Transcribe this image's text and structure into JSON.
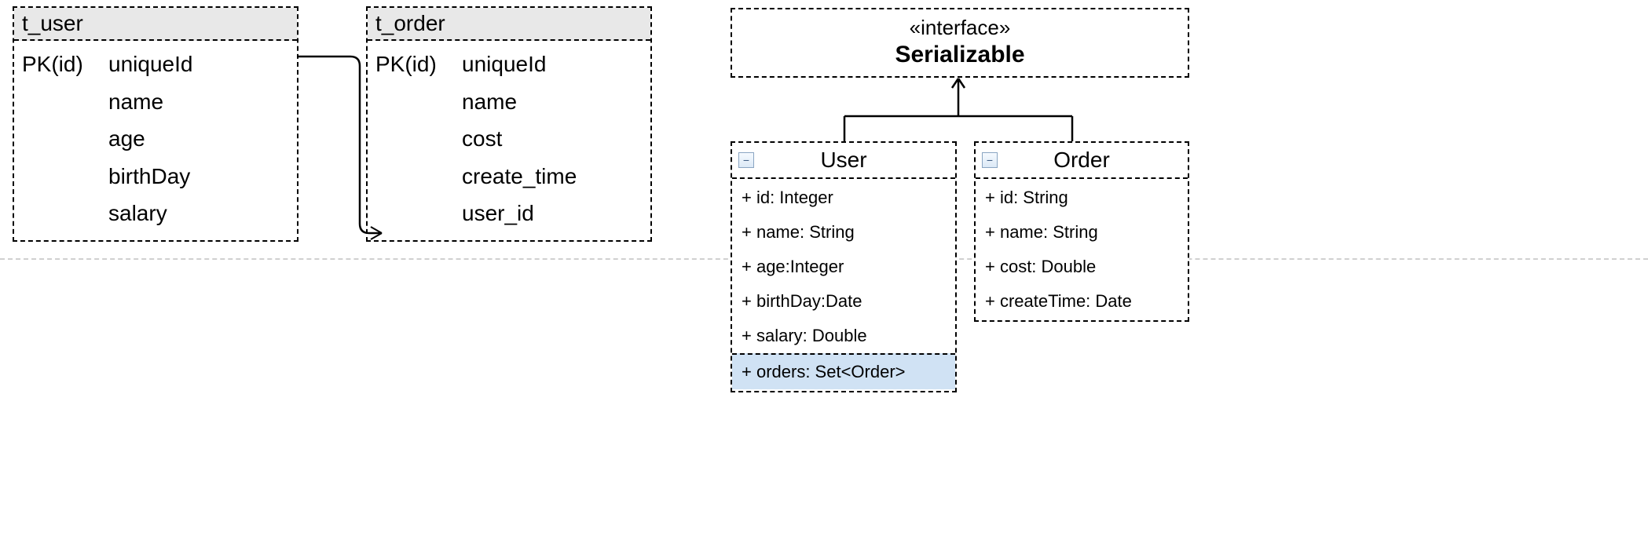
{
  "db": {
    "user": {
      "name": "t_user",
      "pk": "PK(id)",
      "cols": [
        "uniqueId",
        "name",
        "age",
        "birthDay",
        "salary"
      ]
    },
    "order": {
      "name": "t_order",
      "pk": "PK(id)",
      "cols": [
        "uniqueId",
        "name",
        "cost",
        "create_time",
        "user_id"
      ]
    }
  },
  "uml": {
    "interface": {
      "stereotype": "«interface»",
      "name": "Serializable"
    },
    "user": {
      "name": "User",
      "attrs": [
        "+ id: Integer",
        "+ name: String",
        "+ age:Integer",
        "+ birthDay:Date",
        "+ salary: Double"
      ],
      "highlight": "+ orders: Set<Order>"
    },
    "order": {
      "name": "Order",
      "attrs": [
        "+ id: String",
        "+ name: String",
        "+ cost: Double",
        "+ createTime: Date"
      ]
    },
    "collapseGlyph": "−"
  }
}
